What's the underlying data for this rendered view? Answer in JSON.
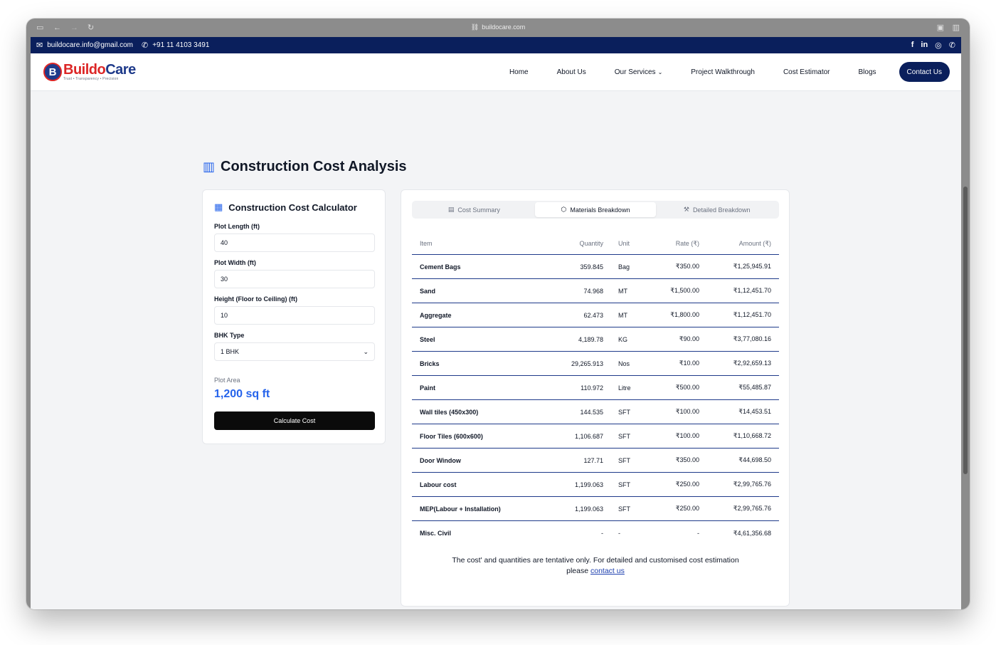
{
  "browser": {
    "url": "buildocare.com"
  },
  "topbar": {
    "email": "buildocare.info@gmail.com",
    "phone": "+91 11 4103 3491",
    "social": [
      "f",
      "in",
      "◎",
      "✆"
    ]
  },
  "nav": {
    "brand_part1": "Buildo",
    "brand_part2": "Care",
    "tagline": "Trust • Transparency • Precision",
    "items": [
      "Home",
      "About Us",
      "Our Services",
      "Project Walkthrough",
      "Cost Estimator",
      "Blogs"
    ],
    "contact_label": "Contact Us"
  },
  "page": {
    "title": "Construction Cost Analysis"
  },
  "calculator": {
    "title": "Construction Cost Calculator",
    "plot_length_label": "Plot Length (ft)",
    "plot_length_value": "40",
    "plot_width_label": "Plot Width (ft)",
    "plot_width_value": "30",
    "height_label": "Height (Floor to Ceiling) (ft)",
    "height_value": "10",
    "bhk_label": "BHK Type",
    "bhk_value": "1 BHK",
    "area_label": "Plot Area",
    "area_value": "1,200 sq ft",
    "button_label": "Calculate Cost"
  },
  "tabs": [
    {
      "label": "Cost Summary",
      "active": false
    },
    {
      "label": "Materials Breakdown",
      "active": true
    },
    {
      "label": "Detailed Breakdown",
      "active": false
    }
  ],
  "table": {
    "headers": [
      "Item",
      "Quantity",
      "Unit",
      "Rate (₹)",
      "Amount (₹)"
    ],
    "rows": [
      [
        "Cement Bags",
        "359.845",
        "Bag",
        "₹350.00",
        "₹1,25,945.91"
      ],
      [
        "Sand",
        "74.968",
        "MT",
        "₹1,500.00",
        "₹1,12,451.70"
      ],
      [
        "Aggregate",
        "62.473",
        "MT",
        "₹1,800.00",
        "₹1,12,451.70"
      ],
      [
        "Steel",
        "4,189.78",
        "KG",
        "₹90.00",
        "₹3,77,080.16"
      ],
      [
        "Bricks",
        "29,265.913",
        "Nos",
        "₹10.00",
        "₹2,92,659.13"
      ],
      [
        "Paint",
        "110.972",
        "Litre",
        "₹500.00",
        "₹55,485.87"
      ],
      [
        "Wall tiles (450x300)",
        "144.535",
        "SFT",
        "₹100.00",
        "₹14,453.51"
      ],
      [
        "Floor Tiles (600x600)",
        "1,106.687",
        "SFT",
        "₹100.00",
        "₹1,10,668.72"
      ],
      [
        "Door Window",
        "127.71",
        "SFT",
        "₹350.00",
        "₹44,698.50"
      ],
      [
        "Labour cost",
        "1,199.063",
        "SFT",
        "₹250.00",
        "₹2,99,765.76"
      ],
      [
        "MEP(Labour + Installation)",
        "1,199.063",
        "SFT",
        "₹250.00",
        "₹2,99,765.76"
      ],
      [
        "Misc. Civil",
        "-",
        "-",
        "-",
        "₹4,61,356.68"
      ]
    ]
  },
  "note": {
    "text_line1": "The cost' and quantities are tentative only. For detailed and customised cost estimation",
    "text_line2": "please",
    "link": "contact us"
  }
}
